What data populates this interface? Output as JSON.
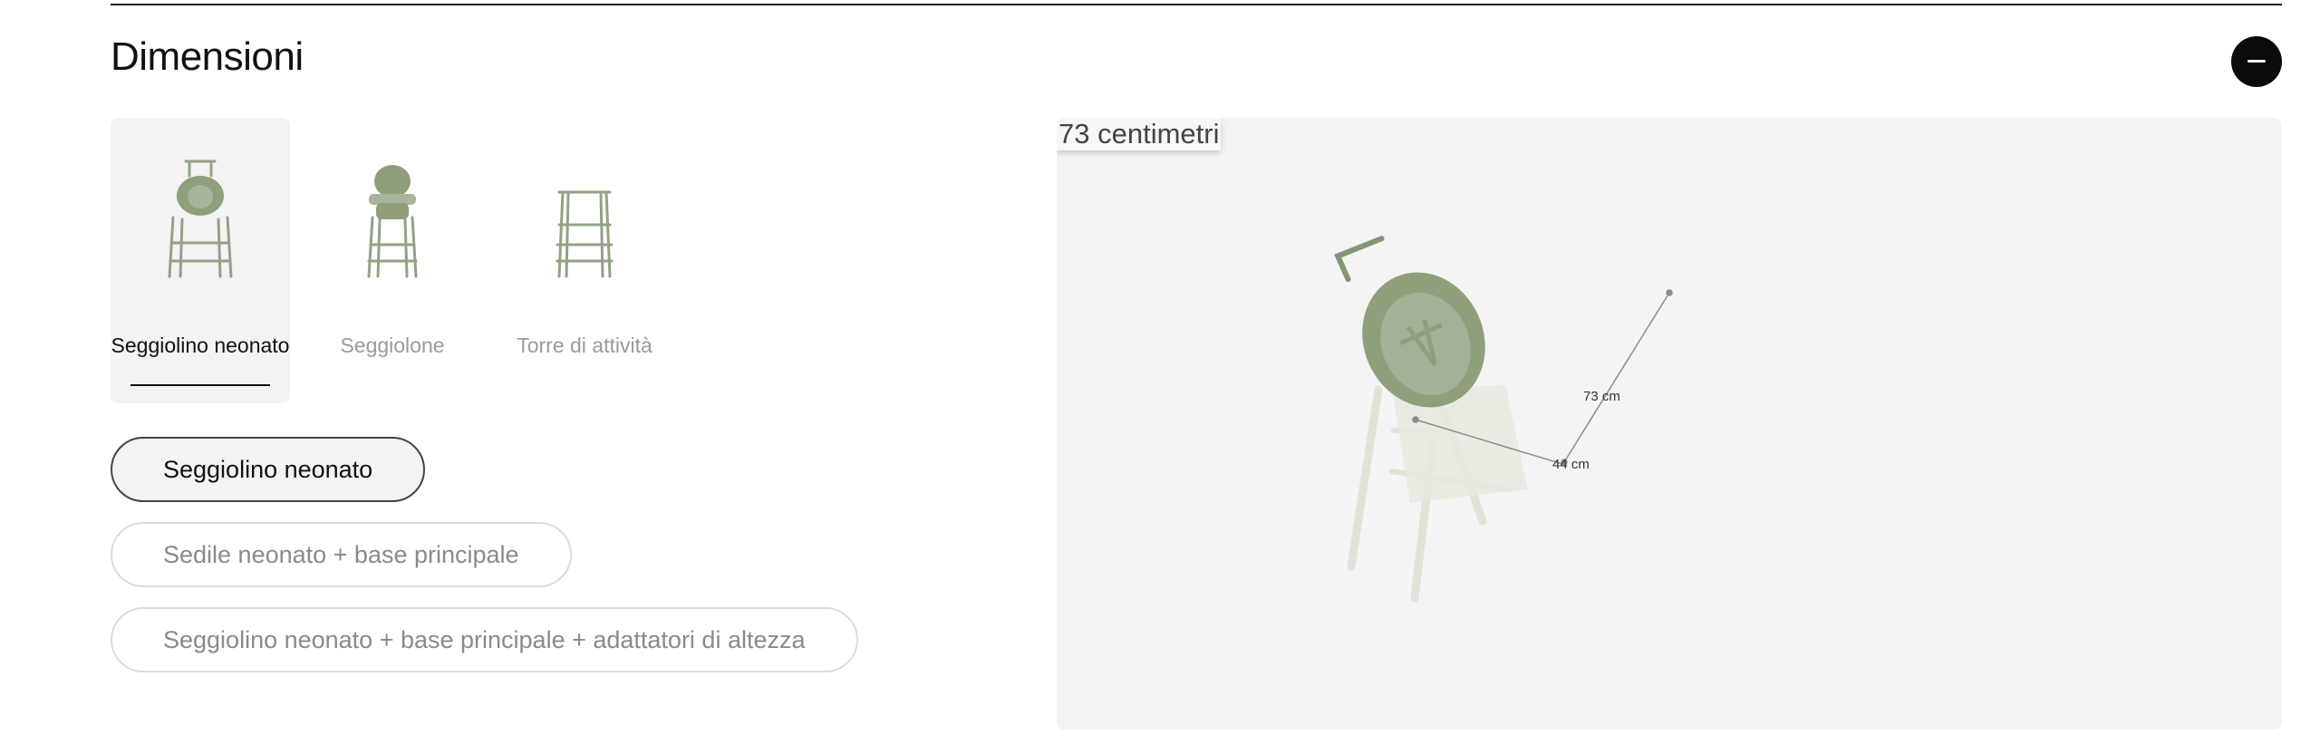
{
  "section": {
    "title": "Dimensioni",
    "collapse_icon": "minus-icon"
  },
  "configurations": [
    {
      "label": "Seggiolino neonato",
      "selected": true
    },
    {
      "label": "Seggiolone",
      "selected": false
    },
    {
      "label": "Torre di attività",
      "selected": false
    }
  ],
  "variants": [
    {
      "label": "Seggiolino neonato",
      "selected": true
    },
    {
      "label": "Sedile neonato + base principale",
      "selected": false
    },
    {
      "label": "Seggiolino neonato + base principale + adattatori di altezza",
      "selected": false
    }
  ],
  "preview": {
    "caption": "73 centimetri",
    "dimensions": {
      "height_label": "73 cm",
      "width_label": "44 cm"
    }
  },
  "colors": {
    "accent": "#0b0b0b",
    "seat_green": "#8f9f7c",
    "frame_green": "#dfe4d6",
    "panel_bg": "#f4f4f4",
    "selected_bg": "#f4f2f2"
  }
}
